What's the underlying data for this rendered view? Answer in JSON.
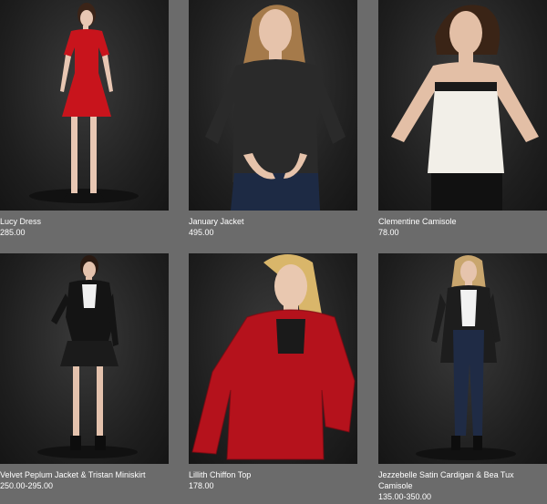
{
  "products": [
    {
      "name": "Lucy Dress",
      "price": "285.00",
      "photo": "model-red-dress"
    },
    {
      "name": "January Jacket",
      "price": "495.00",
      "photo": "model-black-jacket"
    },
    {
      "name": "Clementine Camisole",
      "price": "78.00",
      "photo": "model-white-camisole"
    },
    {
      "name": "Velvet Peplum Jacket & Tristan Miniskirt",
      "price": "250.00-295.00",
      "photo": "model-velvet-jacket"
    },
    {
      "name": "Lillith Chiffon Top",
      "price": "178.00",
      "photo": "model-red-chiffon"
    },
    {
      "name": "Jezzebelle Satin Cardigan & Bea Tux Camisole",
      "price": "135.00-350.00",
      "photo": "model-cardigan"
    }
  ],
  "colors": {
    "page_background": "#6b6b6b",
    "photo_background": "#1e1e1e",
    "text": "#ffffff"
  }
}
